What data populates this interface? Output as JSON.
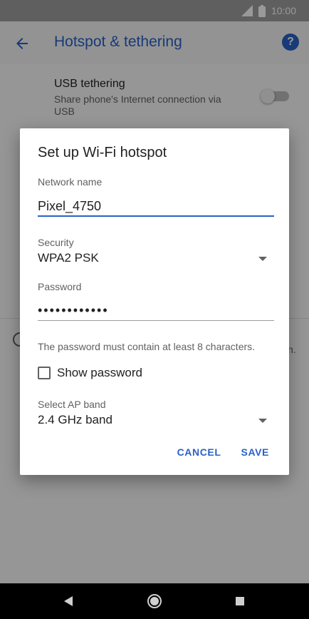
{
  "status_bar": {
    "time": "10:00",
    "icons": [
      "signal-icon",
      "battery-icon"
    ]
  },
  "app_bar": {
    "title": "Hotspot & tethering",
    "back_icon": "arrow-back-icon",
    "help_icon": "help-icon",
    "help_glyph": "?"
  },
  "settings": {
    "usb_tethering": {
      "title": "USB tethering",
      "subtitle": "Share phone's Internet connection via USB",
      "enabled": false
    },
    "partial_text": "n."
  },
  "dialog": {
    "title": "Set up Wi-Fi hotspot",
    "network_name_label": "Network name",
    "network_name_value": "Pixel_4750",
    "security_label": "Security",
    "security_value": "WPA2 PSK",
    "password_label": "Password",
    "password_value": "••••••••••••",
    "password_helper": "The password must contain at least 8 characters.",
    "show_password_label": "Show password",
    "show_password_checked": false,
    "ap_band_label": "Select AP band",
    "ap_band_value": "2.4 GHz band",
    "cancel_label": "CANCEL",
    "save_label": "SAVE"
  },
  "colors": {
    "accent": "#2962c6",
    "scrim": "rgba(0,0,0,0.40)"
  }
}
